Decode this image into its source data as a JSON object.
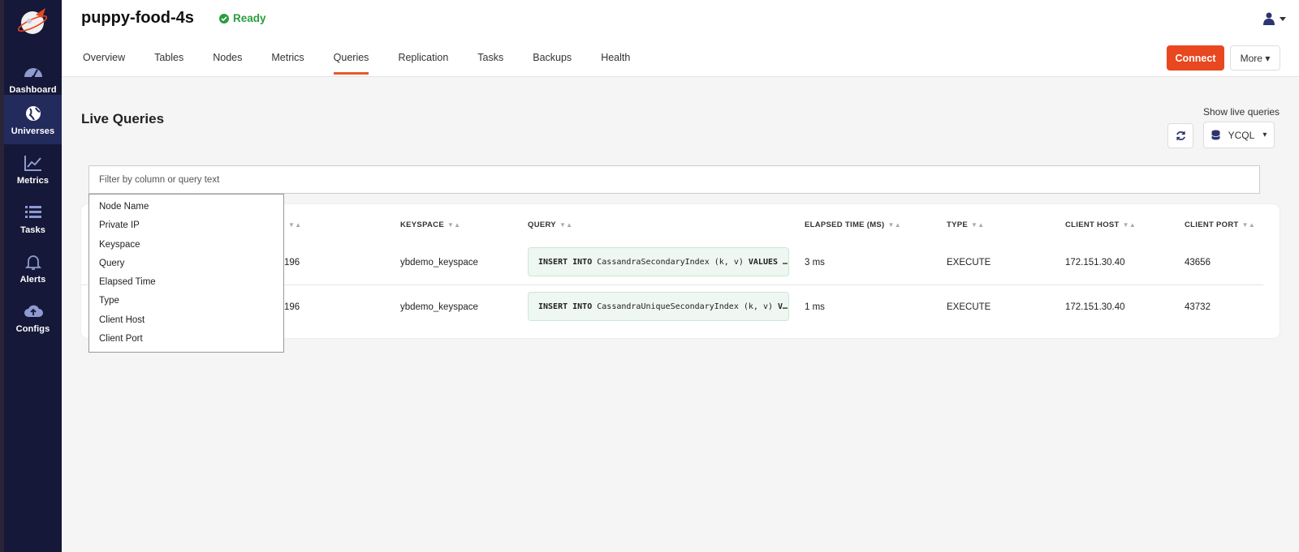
{
  "colors": {
    "sidebar": "#151838",
    "active_nav": "#232a5c",
    "accent": "#e8471f",
    "ready": "#2a9d3e",
    "query_bg": "#eef7f1"
  },
  "sidebar": {
    "items": [
      {
        "label": "Dashboard",
        "icon": "dashboard-icon"
      },
      {
        "label": "Universes",
        "icon": "globe-icon",
        "active": true
      },
      {
        "label": "Metrics",
        "icon": "chart-line-icon"
      },
      {
        "label": "Tasks",
        "icon": "list-icon"
      },
      {
        "label": "Alerts",
        "icon": "bell-icon"
      },
      {
        "label": "Configs",
        "icon": "cloud-upload-icon"
      }
    ]
  },
  "header": {
    "title": "puppy-food-4s",
    "status": "Ready",
    "tabs": [
      "Overview",
      "Tables",
      "Nodes",
      "Metrics",
      "Queries",
      "Replication",
      "Tasks",
      "Backups",
      "Health"
    ],
    "active_tab": "Queries",
    "connect_label": "Connect",
    "more_label": "More"
  },
  "main": {
    "section_title": "Live Queries",
    "show_live_label": "Show live queries",
    "api_selector": "YCQL",
    "filter_placeholder": "Filter by column or query text",
    "dropdown_options": [
      "Node Name",
      "Private IP",
      "Keyspace",
      "Query",
      "Elapsed Time",
      "Type",
      "Client Host",
      "Client Port"
    ],
    "columns": [
      "KEYSPACE",
      "QUERY",
      "ELAPSED TIME (MS)",
      "TYPE",
      "CLIENT HOST",
      "CLIENT PORT"
    ],
    "rows": [
      {
        "ip_suffix": "196",
        "keyspace": "ybdemo_keyspace",
        "query_kw1": "INSERT INTO",
        "query_mid": " CassandraSecondaryIndex (k, v) ",
        "query_kw2": "VALUES …",
        "elapsed": "3 ms",
        "type": "EXECUTE",
        "client_host": "172.151.30.40",
        "client_port": "43656"
      },
      {
        "ip_suffix": "196",
        "keyspace": "ybdemo_keyspace",
        "query_kw1": "INSERT INTO",
        "query_mid": " CassandraUniqueSecondaryIndex (k, v) ",
        "query_kw2": "V…",
        "elapsed": "1 ms",
        "type": "EXECUTE",
        "client_host": "172.151.30.40",
        "client_port": "43732"
      }
    ]
  }
}
